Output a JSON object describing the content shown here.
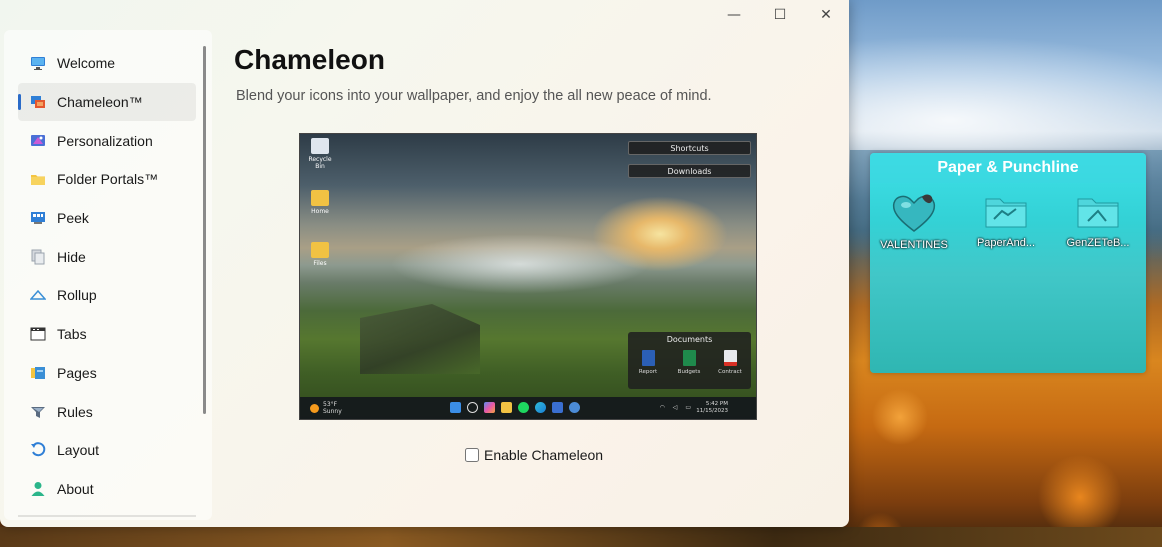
{
  "window": {
    "controls": [
      "—",
      "☐",
      "✕"
    ]
  },
  "sidebar": {
    "items": [
      {
        "label": "Welcome",
        "icon": "monitor-icon"
      },
      {
        "label": "Chameleon™",
        "icon": "chameleon-icon",
        "active": true
      },
      {
        "label": "Personalization",
        "icon": "personalization-icon"
      },
      {
        "label": "Folder Portals™",
        "icon": "folder-icon"
      },
      {
        "label": "Peek",
        "icon": "peek-icon"
      },
      {
        "label": "Hide",
        "icon": "hide-icon"
      },
      {
        "label": "Rollup",
        "icon": "rollup-icon"
      },
      {
        "label": "Tabs",
        "icon": "tabs-icon"
      },
      {
        "label": "Pages",
        "icon": "pages-icon"
      },
      {
        "label": "Rules",
        "icon": "rules-icon"
      },
      {
        "label": "Layout",
        "icon": "layout-icon"
      },
      {
        "label": "About",
        "icon": "about-icon"
      }
    ]
  },
  "main": {
    "title": "Chameleon",
    "subtitle": "Blend your icons into your wallpaper, and enjoy the all new peace of mind.",
    "enable_label": "Enable Chameleon",
    "enable_checked": false
  },
  "preview": {
    "desktop_icons": [
      "Recycle Bin",
      "Home",
      "Files"
    ],
    "fences": [
      "Shortcuts",
      "Downloads"
    ],
    "documents": {
      "title": "Documents",
      "items": [
        "Report",
        "Budgets",
        "Contract"
      ]
    },
    "taskbar": {
      "temperature": "53°F",
      "condition": "Sunny",
      "time": "5:42 PM",
      "date": "11/15/2023"
    }
  },
  "fence": {
    "title": "Paper & Punchline",
    "items": [
      "VALENTINES",
      "PaperAnd...",
      "GenZETeB..."
    ]
  },
  "colors": {
    "accent": "#2a6bc8",
    "fence": "#33d2d6"
  }
}
